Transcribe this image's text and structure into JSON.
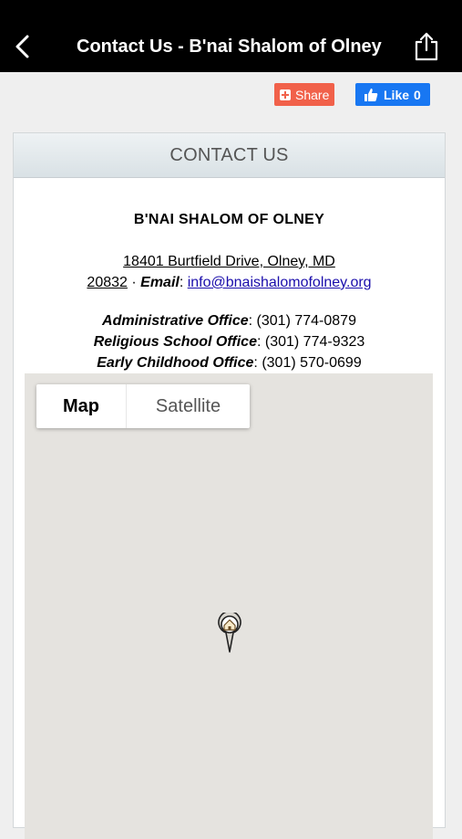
{
  "header": {
    "title": "Contact Us - B'nai Shalom of Olney",
    "back_icon": "chevron-left-icon",
    "share_icon": "share-upload-icon"
  },
  "social": {
    "share_label": "Share",
    "like_label": "Like",
    "like_count": "0"
  },
  "contact": {
    "section_title": "CONTACT US",
    "org_name": "B'NAI SHALOM OF OLNEY",
    "address_line1": "18401 Burtfield Drive, Olney, MD",
    "zip": "20832",
    "separator": " · ",
    "email_label": "Email",
    "email": "info@bnaishalomofolney.org",
    "offices": [
      {
        "label": "Administrative Office",
        "phone": "(301) 774-0879"
      },
      {
        "label": "Religious School Office",
        "phone": "(301) 774-9323"
      },
      {
        "label": "Early Childhood Office",
        "phone": "(301) 570-0699"
      }
    ]
  },
  "map": {
    "map_label": "Map",
    "satellite_label": "Satellite",
    "marker_icon": "map-pin-home-icon"
  },
  "colors": {
    "share_button": "#f1614a",
    "like_button": "#1877f2",
    "topbar": "#000000",
    "link": "#1a0dab"
  }
}
